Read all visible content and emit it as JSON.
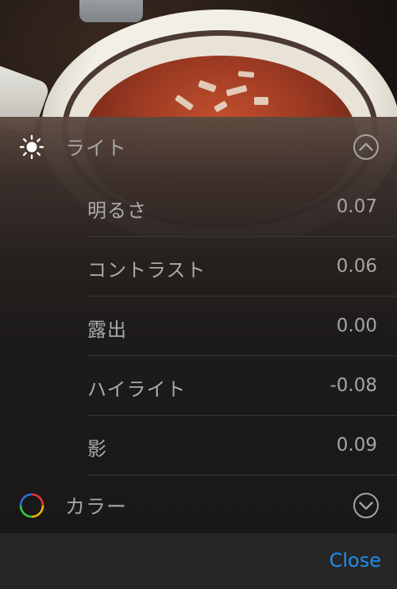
{
  "sections": [
    {
      "label": "ライト",
      "icon": "sun-icon",
      "state": "expanded"
    },
    {
      "label": "カラー",
      "icon": "color-wheel-icon",
      "state": "collapsed"
    }
  ],
  "light_adjustments": [
    {
      "label": "明るさ",
      "value": "0.07"
    },
    {
      "label": "コントラスト",
      "value": "0.06"
    },
    {
      "label": "露出",
      "value": "0.00"
    },
    {
      "label": "ハイライト",
      "value": "-0.08"
    },
    {
      "label": "影",
      "value": "0.09"
    }
  ],
  "footer": {
    "close_label": "Close"
  },
  "colors": {
    "accent": "#1e8ff0",
    "text": "#a5a5a5",
    "panel": "#191818",
    "bar": "#262626"
  }
}
